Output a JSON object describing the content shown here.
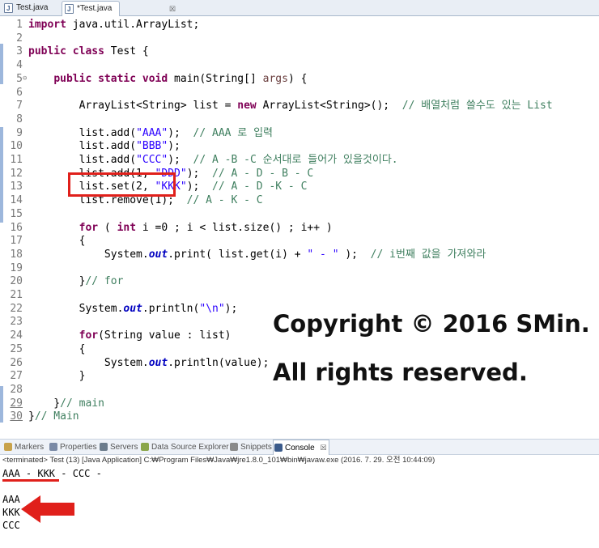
{
  "tabs": [
    {
      "label": "Test.java",
      "active": false
    },
    {
      "label": "*Test.java",
      "active": true,
      "close_icon": "close-icon"
    }
  ],
  "editor": {
    "lines": [
      {
        "n": "1",
        "segs": [
          [
            "kw",
            "import"
          ],
          [
            "p",
            " java.util.ArrayList;"
          ]
        ]
      },
      {
        "n": "2",
        "segs": []
      },
      {
        "n": "3",
        "segs": [
          [
            "kw",
            "public"
          ],
          [
            "p",
            " "
          ],
          [
            "kw",
            "class"
          ],
          [
            "p",
            " Test {"
          ]
        ]
      },
      {
        "n": "4",
        "segs": []
      },
      {
        "n": "5",
        "fold": "⊖",
        "segs": [
          [
            "p",
            "    "
          ],
          [
            "kw",
            "public"
          ],
          [
            "p",
            " "
          ],
          [
            "kw",
            "static"
          ],
          [
            "p",
            " "
          ],
          [
            "kw",
            "void"
          ],
          [
            "p",
            " main(String[] "
          ],
          [
            "param",
            "args"
          ],
          [
            "p",
            ") {"
          ]
        ]
      },
      {
        "n": "6",
        "segs": []
      },
      {
        "n": "7",
        "segs": [
          [
            "p",
            "        ArrayList<String> list = "
          ],
          [
            "kw",
            "new"
          ],
          [
            "p",
            " ArrayList<String>();  "
          ],
          [
            "cm",
            "// 배열처럼 쓸수도 있는 List"
          ]
        ]
      },
      {
        "n": "8",
        "segs": []
      },
      {
        "n": "9",
        "segs": [
          [
            "p",
            "        list.add("
          ],
          [
            "str",
            "\"AAA\""
          ],
          [
            "p",
            ");  "
          ],
          [
            "cm",
            "// AAA 로 입력"
          ]
        ]
      },
      {
        "n": "10",
        "segs": [
          [
            "p",
            "        list.add("
          ],
          [
            "str",
            "\"BBB\""
          ],
          [
            "p",
            ");"
          ]
        ]
      },
      {
        "n": "11",
        "segs": [
          [
            "p",
            "        list.add("
          ],
          [
            "str",
            "\"CCC\""
          ],
          [
            "p",
            ");  "
          ],
          [
            "cm",
            "// A -B -C 순서대로 들어가 있을것이다."
          ]
        ]
      },
      {
        "n": "12",
        "segs": [
          [
            "p",
            "        list.add(1, "
          ],
          [
            "str",
            "\"DDD\""
          ],
          [
            "p",
            ");  "
          ],
          [
            "cm",
            "// A - D - B - C"
          ]
        ]
      },
      {
        "n": "13",
        "segs": [
          [
            "p",
            "        list.set(2, "
          ],
          [
            "str",
            "\"KKK\""
          ],
          [
            "p",
            ");  "
          ],
          [
            "cm",
            "// A - D -K - C"
          ]
        ]
      },
      {
        "n": "14",
        "segs": [
          [
            "p",
            "        list.remove(1);  "
          ],
          [
            "cm",
            "// A - K - C"
          ]
        ]
      },
      {
        "n": "15",
        "segs": []
      },
      {
        "n": "16",
        "segs": [
          [
            "p",
            "        "
          ],
          [
            "kw",
            "for"
          ],
          [
            "p",
            " ( "
          ],
          [
            "kw",
            "int"
          ],
          [
            "p",
            " i =0 ; i < list.size() ; i++ )"
          ]
        ]
      },
      {
        "n": "17",
        "segs": [
          [
            "p",
            "        {"
          ]
        ]
      },
      {
        "n": "18",
        "segs": [
          [
            "p",
            "            System."
          ],
          [
            "fld",
            "out"
          ],
          [
            "p",
            ".print( list.get(i) + "
          ],
          [
            "str",
            "\" - \""
          ],
          [
            "p",
            " );  "
          ],
          [
            "cm",
            "// i번째 값을 가져와라"
          ]
        ]
      },
      {
        "n": "19",
        "segs": []
      },
      {
        "n": "20",
        "segs": [
          [
            "p",
            "        }"
          ],
          [
            "cm",
            "// for"
          ]
        ]
      },
      {
        "n": "21",
        "segs": []
      },
      {
        "n": "22",
        "segs": [
          [
            "p",
            "        System."
          ],
          [
            "fld",
            "out"
          ],
          [
            "p",
            ".println("
          ],
          [
            "str",
            "\"\\n\""
          ],
          [
            "p",
            ");"
          ]
        ]
      },
      {
        "n": "23",
        "segs": []
      },
      {
        "n": "24",
        "segs": [
          [
            "p",
            "        "
          ],
          [
            "kw",
            "for"
          ],
          [
            "p",
            "(String value : list)"
          ]
        ]
      },
      {
        "n": "25",
        "segs": [
          [
            "p",
            "        {"
          ]
        ]
      },
      {
        "n": "26",
        "segs": [
          [
            "p",
            "            System."
          ],
          [
            "fld",
            "out"
          ],
          [
            "p",
            ".println(value);"
          ]
        ]
      },
      {
        "n": "27",
        "segs": [
          [
            "p",
            "        }"
          ]
        ]
      },
      {
        "n": "28",
        "segs": []
      },
      {
        "n": "29",
        "ul": true,
        "segs": [
          [
            "p",
            "    }"
          ],
          [
            "cm",
            "// main"
          ]
        ]
      },
      {
        "n": "30",
        "ul": true,
        "segs": [
          [
            "p",
            "}"
          ],
          [
            "cm",
            "// Main"
          ]
        ]
      }
    ]
  },
  "overlay": {
    "copyright_line1": "Copyright © 2016 SMin.",
    "copyright_line2": "All rights reserved."
  },
  "panel": {
    "tabs": [
      {
        "label": "Markers",
        "icon": "markers-icon",
        "color": "#c8a24a"
      },
      {
        "label": "Properties",
        "icon": "properties-icon",
        "color": "#7a8aa6"
      },
      {
        "label": "Servers",
        "icon": "servers-icon",
        "color": "#6c7c8c"
      },
      {
        "label": "Data Source Explorer",
        "icon": "data-source-icon",
        "color": "#8aa64a"
      },
      {
        "label": "Snippets",
        "icon": "snippets-icon",
        "color": "#8a8a8a"
      },
      {
        "label": "Console",
        "icon": "console-icon",
        "color": "#3a5a8a",
        "active": true
      }
    ],
    "close_label": "☒"
  },
  "console": {
    "terminated": "<terminated> Test (13) [Java Application] C:₩Program Files₩Java₩jre1.8.0_101₩bin₩javaw.exe (2016. 7. 29. 오전 10:44:09)",
    "output": [
      "AAA - KKK - CCC -",
      "",
      "AAA",
      "KKK",
      "CCC"
    ]
  },
  "colors": {
    "highlight_red": "#e0201b",
    "keyword": "#7f0055",
    "comment": "#3f7f5f",
    "string": "#2a00ff"
  }
}
